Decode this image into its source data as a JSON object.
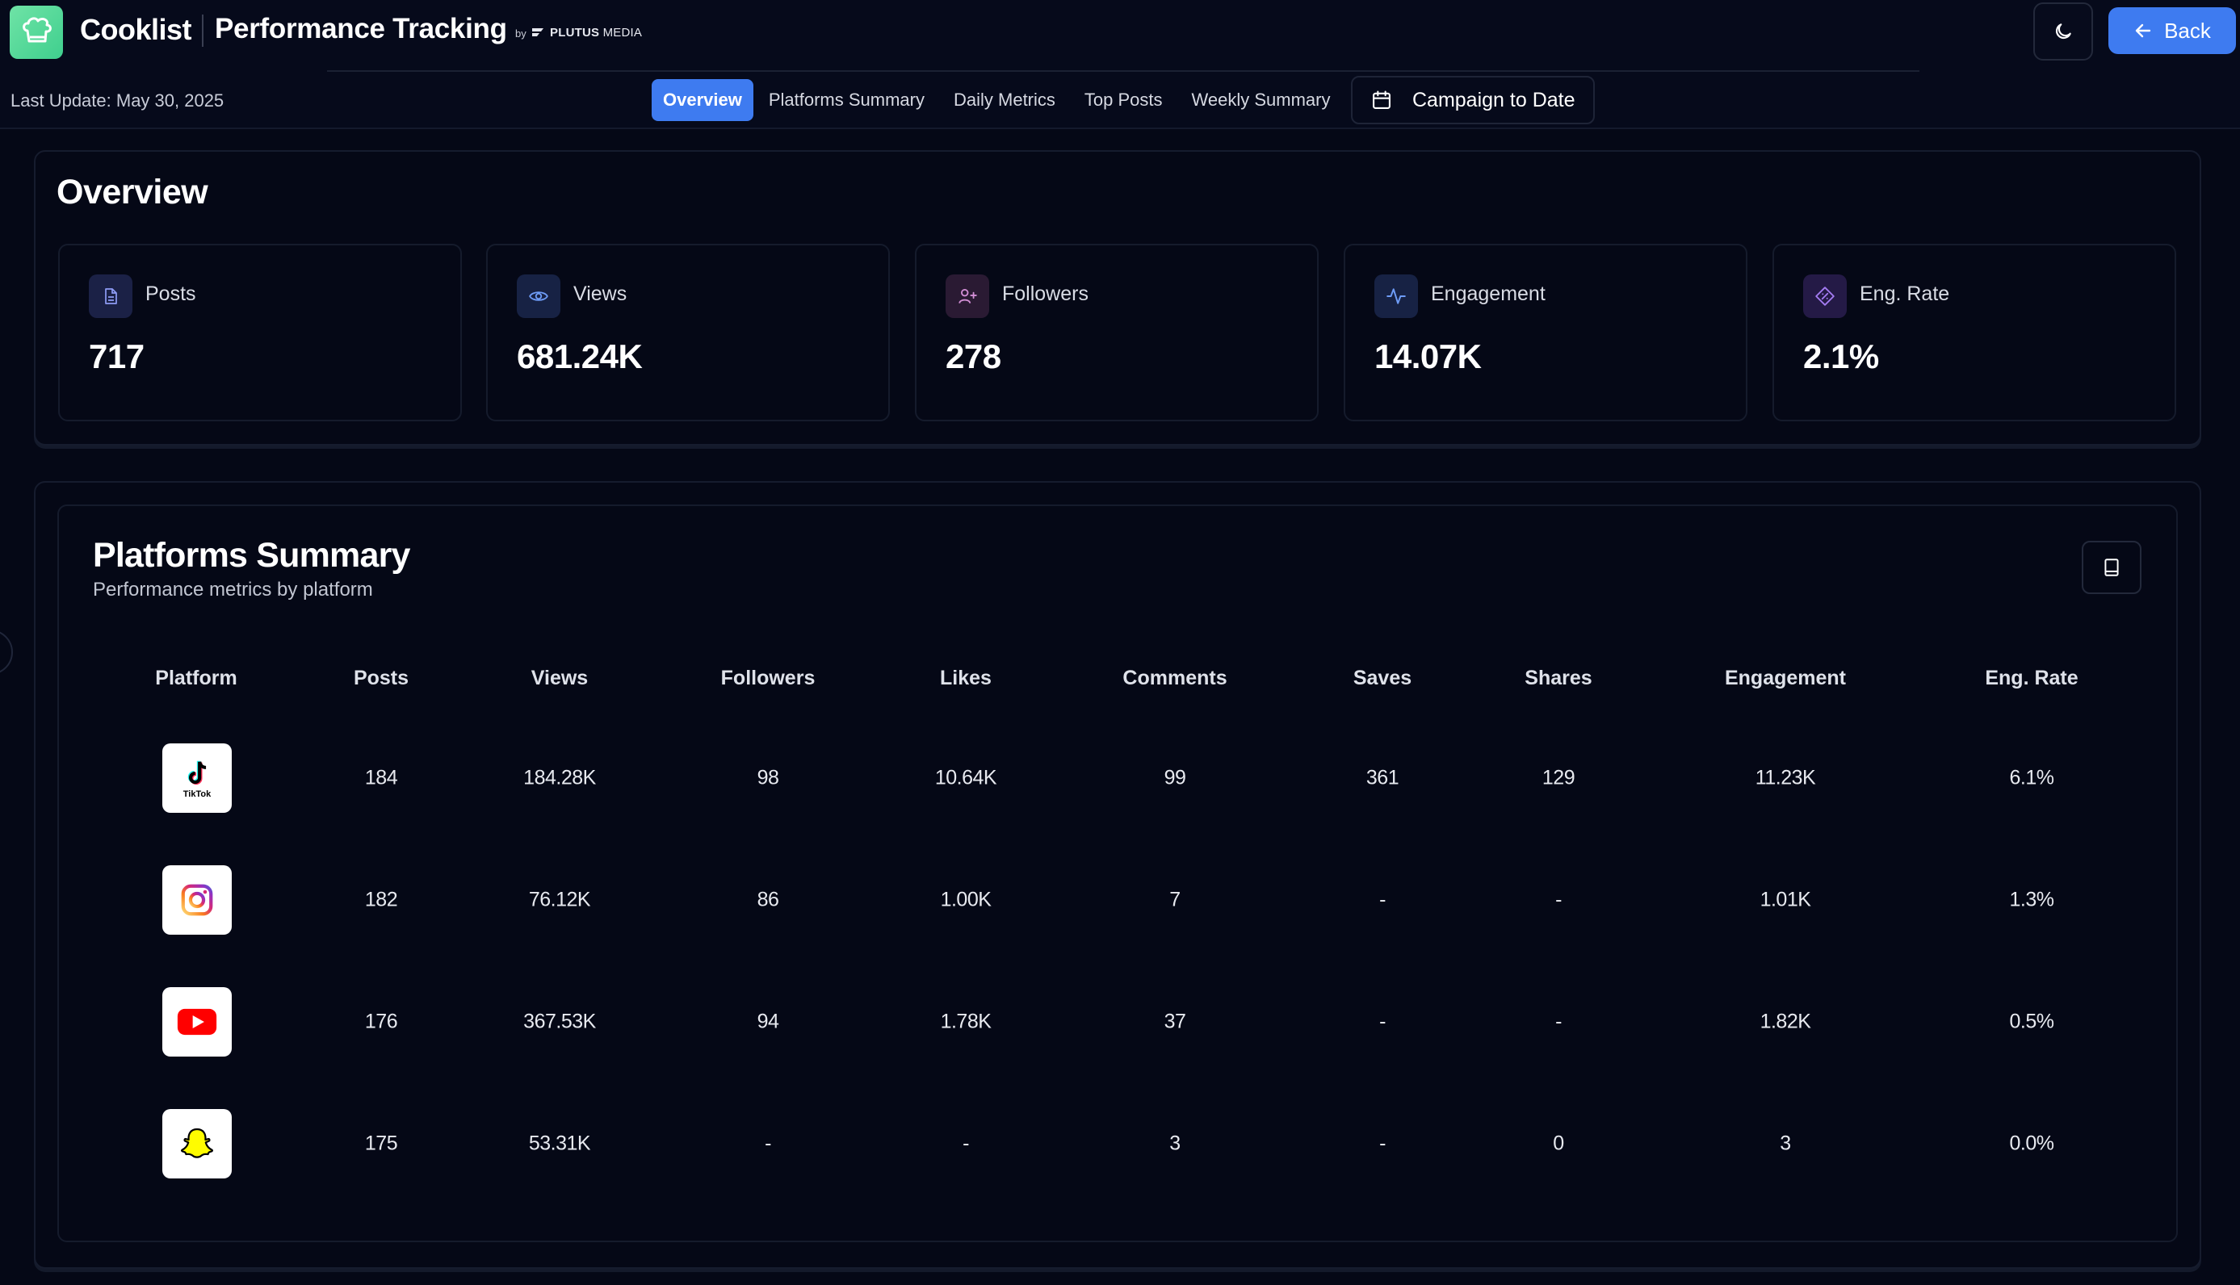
{
  "header": {
    "app_name": "Cooklist",
    "page_title": "Performance Tracking",
    "by_label": "by",
    "brand_strong": "PLUTUS",
    "brand_light": "MEDIA",
    "back_label": "Back",
    "last_update": "Last Update: May 30, 2025",
    "accent_color": "#3e7bf0"
  },
  "nav": {
    "tabs": [
      "Overview",
      "Platforms Summary",
      "Daily Metrics",
      "Top Posts",
      "Weekly Summary"
    ],
    "active_tab": "Overview",
    "date_range": "Campaign to Date"
  },
  "overview": {
    "title": "Overview",
    "stats": [
      {
        "label": "Posts",
        "value": "717",
        "icon": "document-icon"
      },
      {
        "label": "Views",
        "value": "681.24K",
        "icon": "eye-icon"
      },
      {
        "label": "Followers",
        "value": "278",
        "icon": "user-plus-icon"
      },
      {
        "label": "Engagement",
        "value": "14.07K",
        "icon": "activity-icon"
      },
      {
        "label": "Eng. Rate",
        "value": "2.1%",
        "icon": "diamond-percent-icon"
      }
    ]
  },
  "platforms": {
    "title": "Platforms Summary",
    "subtitle": "Performance metrics by platform",
    "columns": [
      "Platform",
      "Posts",
      "Views",
      "Followers",
      "Likes",
      "Comments",
      "Saves",
      "Shares",
      "Engagement",
      "Eng. Rate"
    ],
    "rows": [
      {
        "platform_icon": "tiktok-icon",
        "platform_text": "TikTok",
        "cells": [
          "184",
          "184.28K",
          "98",
          "10.64K",
          "99",
          "361",
          "129",
          "11.23K",
          "6.1%"
        ]
      },
      {
        "platform_icon": "instagram-icon",
        "cells": [
          "182",
          "76.12K",
          "86",
          "1.00K",
          "7",
          "-",
          "-",
          "1.01K",
          "1.3%"
        ]
      },
      {
        "platform_icon": "youtube-icon",
        "cells": [
          "176",
          "367.53K",
          "94",
          "1.78K",
          "37",
          "-",
          "-",
          "1.82K",
          "0.5%"
        ]
      },
      {
        "platform_icon": "snapchat-icon",
        "cells": [
          "175",
          "53.31K",
          "-",
          "-",
          "3",
          "-",
          "0",
          "3",
          "0.0%"
        ]
      }
    ]
  }
}
